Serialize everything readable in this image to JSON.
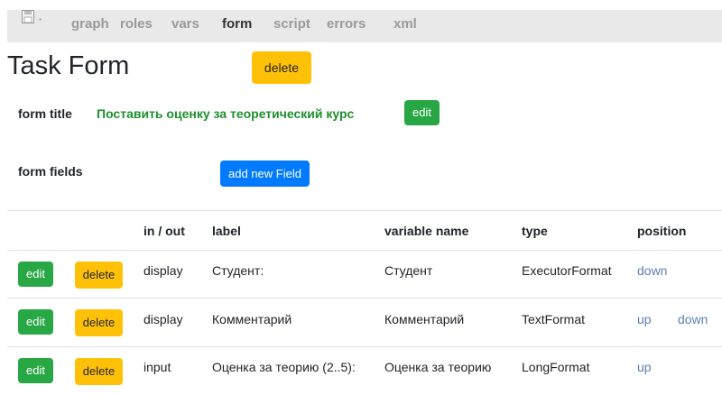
{
  "nav": {
    "items": [
      {
        "label": "graph"
      },
      {
        "label": "roles"
      },
      {
        "label": "vars"
      },
      {
        "label": "form"
      },
      {
        "label": "script"
      },
      {
        "label": "errors"
      },
      {
        "label": "xml"
      }
    ],
    "active": "form",
    "save_marker": "*"
  },
  "page": {
    "title": "Task Form",
    "delete_label": "delete"
  },
  "form_title": {
    "label": "form title",
    "value": "Поставить оценку за теоретический курс",
    "edit_label": "edit"
  },
  "form_fields": {
    "label": "form fields",
    "add_label": "add new Field"
  },
  "table": {
    "headers": {
      "inout": "in / out",
      "label": "label",
      "variable_name": "variable name",
      "type": "type",
      "position": "position"
    },
    "rows": [
      {
        "edit": "edit",
        "delete": "delete",
        "inout": "display",
        "label": "Студент:",
        "variable": "Студент",
        "type": "ExecutorFormat",
        "up": "",
        "down": "down"
      },
      {
        "edit": "edit",
        "delete": "delete",
        "inout": "display",
        "label": "Комментарий",
        "variable": "Комментарий",
        "type": "TextFormat",
        "up": "up",
        "down": "down"
      },
      {
        "edit": "edit",
        "delete": "delete",
        "inout": "input",
        "label": "Оценка за теорию (2..5):",
        "variable": "Оценка за теорию",
        "type": "LongFormat",
        "up": "up",
        "down": ""
      }
    ]
  },
  "colors": {
    "warning": "#ffc107",
    "success": "#28a745",
    "primary": "#007bff",
    "link": "#5b7fb0",
    "title_green": "#1e8f2f"
  }
}
